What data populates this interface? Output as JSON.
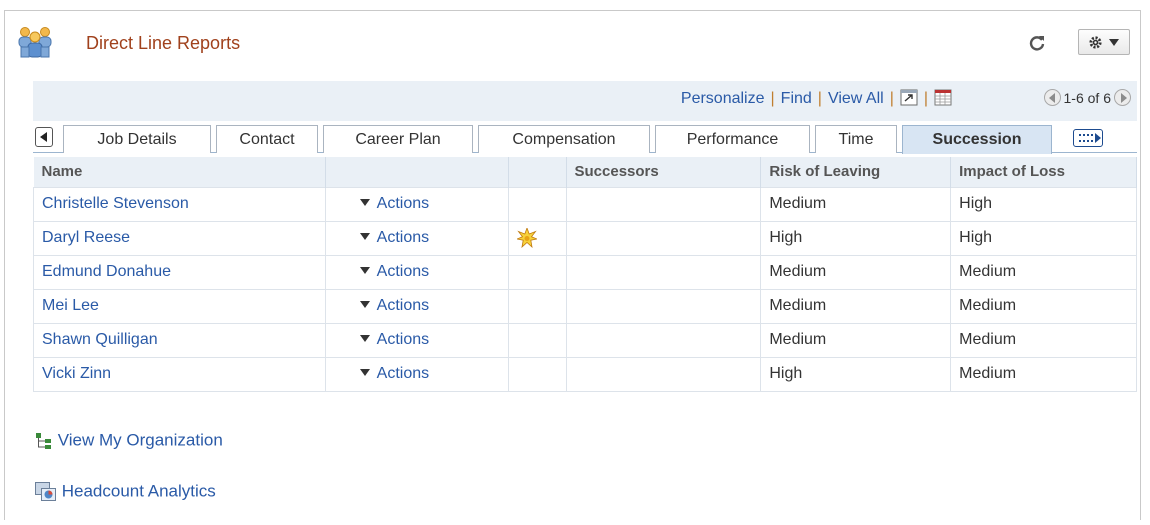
{
  "header": {
    "title": "Direct Line Reports",
    "icon": "people-group-icon"
  },
  "toolbar": {
    "personalize": "Personalize",
    "find": "Find",
    "view_all": "View All",
    "sep": "|",
    "pager": "1-6 of 6"
  },
  "tabs": [
    {
      "label": "Job Details"
    },
    {
      "label": "Contact"
    },
    {
      "label": "Career Plan"
    },
    {
      "label": "Compensation"
    },
    {
      "label": "Performance"
    },
    {
      "label": "Time"
    },
    {
      "label": "Succession",
      "active": true
    }
  ],
  "table": {
    "columns": [
      "Name",
      "",
      "",
      "Successors",
      "Risk of Leaving",
      "Impact of Loss"
    ],
    "rows": [
      {
        "name": "Christelle Stevenson",
        "actions": "Actions",
        "flag": "",
        "successors": "",
        "risk": "Medium",
        "impact": "High"
      },
      {
        "name": "Daryl Reese",
        "actions": "Actions",
        "flag": "star",
        "successors": "",
        "risk": "High",
        "impact": "High"
      },
      {
        "name": "Edmund Donahue",
        "actions": "Actions",
        "flag": "",
        "successors": "",
        "risk": "Medium",
        "impact": "Medium"
      },
      {
        "name": "Mei Lee",
        "actions": "Actions",
        "flag": "",
        "successors": "",
        "risk": "Medium",
        "impact": "Medium"
      },
      {
        "name": "Shawn Quilligan",
        "actions": "Actions",
        "flag": "",
        "successors": "",
        "risk": "Medium",
        "impact": "Medium"
      },
      {
        "name": "Vicki Zinn",
        "actions": "Actions",
        "flag": "",
        "successors": "",
        "risk": "High",
        "impact": "Medium"
      }
    ]
  },
  "links": {
    "view_org": "View My Organization",
    "headcount": "Headcount Analytics"
  },
  "colors": {
    "title": "#a0411c",
    "link": "#2a5aa7",
    "header_bg": "#eaf0f6",
    "active_tab": "#d8e5f3"
  }
}
